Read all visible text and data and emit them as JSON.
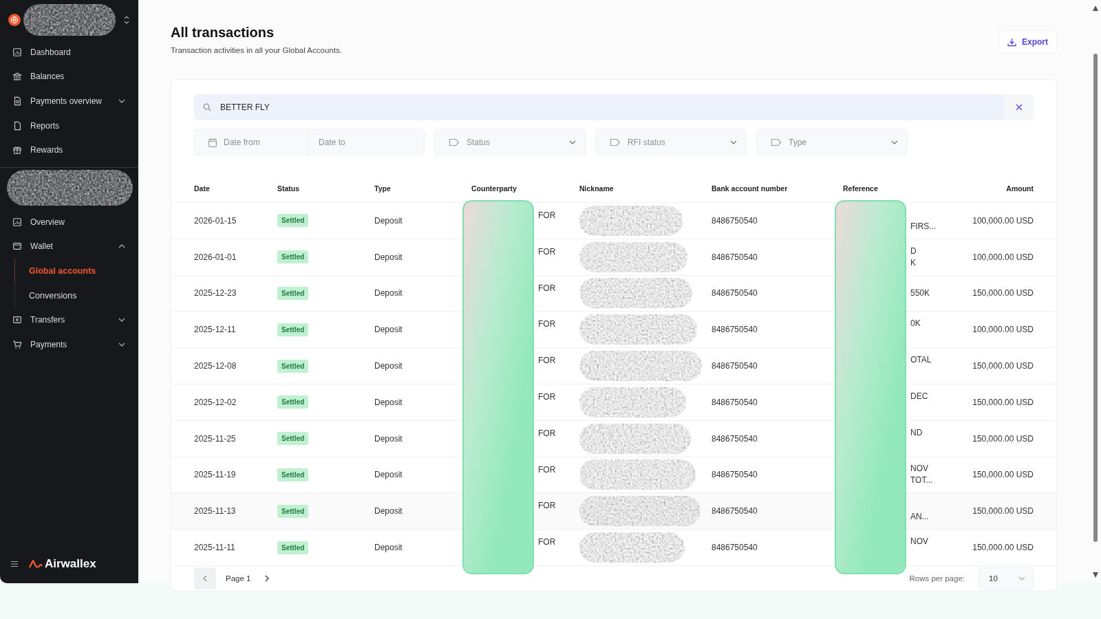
{
  "sidebar": {
    "items": [
      {
        "label": "Dashboard"
      },
      {
        "label": "Balances"
      },
      {
        "label": "Payments overview",
        "expanded": false
      },
      {
        "label": "Reports"
      },
      {
        "label": "Rewards"
      }
    ],
    "section_items": [
      {
        "label": "Overview"
      },
      {
        "label": "Wallet",
        "expanded": true,
        "children": [
          {
            "label": "Global accounts",
            "selected": true
          },
          {
            "label": "Conversions",
            "selected": false
          }
        ]
      },
      {
        "label": "Transfers",
        "expanded": false
      },
      {
        "label": "Payments",
        "expanded": false
      }
    ],
    "brand": "Airwallex"
  },
  "page": {
    "title": "All transactions",
    "subtitle": "Transaction activities in all your Global Accounts.",
    "export_button": "Export"
  },
  "search": {
    "value": "BETTER FLY"
  },
  "filters": {
    "date_from": {
      "placeholder": "Date from"
    },
    "date_to": {
      "placeholder": "Date to"
    },
    "dropdowns": [
      {
        "placeholder": "Status"
      },
      {
        "placeholder": "RFI status"
      },
      {
        "placeholder": "Type"
      }
    ]
  },
  "table": {
    "columns": [
      "Date",
      "Status",
      "Type",
      "Counterparty",
      "Nickname",
      "Bank account number",
      "Reference",
      "Amount"
    ],
    "rows": [
      {
        "date": "2026-01-15",
        "status": "Settled",
        "type": "Deposit",
        "counterparty": "FOR",
        "bank_account": "8486750540",
        "reference_line_2": "FIRS...",
        "amount": "100,000.00 USD"
      },
      {
        "date": "2026-01-01",
        "status": "Settled",
        "type": "Deposit",
        "counterparty": "FOR",
        "bank_account": "8486750540",
        "reference_line_1": "D",
        "reference_line_2": "K",
        "amount": "100,000.00 USD"
      },
      {
        "date": "2025-12-23",
        "status": "Settled",
        "type": "Deposit",
        "counterparty": "FOR",
        "bank_account": "8486750540",
        "reference_middle": "550K",
        "amount": "150,000.00 USD"
      },
      {
        "date": "2025-12-11",
        "status": "Settled",
        "type": "Deposit",
        "counterparty": "FOR",
        "bank_account": "8486750540",
        "reference_line_1": "0K",
        "amount": "100,000.00 USD"
      },
      {
        "date": "2025-12-08",
        "status": "Settled",
        "type": "Deposit",
        "counterparty": "FOR",
        "bank_account": "8486750540",
        "reference_line_1": "OTAL",
        "amount": "150,000.00 USD"
      },
      {
        "date": "2025-12-02",
        "status": "Settled",
        "type": "Deposit",
        "counterparty": "FOR",
        "bank_account": "8486750540",
        "reference_line_1": "DEC",
        "amount": "150,000.00 USD"
      },
      {
        "date": "2025-11-25",
        "status": "Settled",
        "type": "Deposit",
        "counterparty": "FOR",
        "bank_account": "8486750540",
        "reference_line_1": "ND",
        "amount": "150,000.00 USD"
      },
      {
        "date": "2025-11-19",
        "status": "Settled",
        "type": "Deposit",
        "counterparty": "FOR",
        "bank_account": "8486750540",
        "reference_line_1": "NOV",
        "reference_line_2": "TOT...",
        "amount": "150,000.00 USD"
      },
      {
        "date": "2025-11-13",
        "status": "Settled",
        "type": "Deposit",
        "counterparty": "FOR",
        "bank_account": "8486750540",
        "reference_line_2": "AN...",
        "amount": "150,000.00 USD"
      },
      {
        "date": "2025-11-11",
        "status": "Settled",
        "type": "Deposit",
        "counterparty": "FOR",
        "bank_account": "8486750540",
        "reference_line_1": "NOV",
        "amount": "150,000.00 USD"
      }
    ]
  },
  "pagination": {
    "page": "Page 1",
    "rows_per_page_label": "Rows per page:",
    "rows_per_page": "10"
  }
}
